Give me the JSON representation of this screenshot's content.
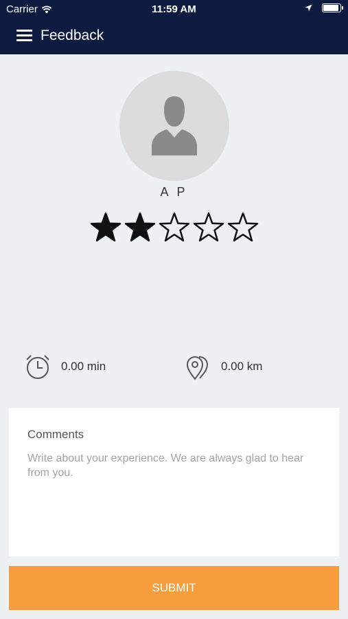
{
  "status_bar": {
    "carrier": "Carrier",
    "time": "11:59 AM",
    "battery_level": 0.95
  },
  "header": {
    "title": "Feedback",
    "menu_icon": "hamburger-icon"
  },
  "driver": {
    "name": "A P",
    "avatar_icon": "person-silhouette-icon"
  },
  "rating": {
    "value": 2,
    "max": 5
  },
  "metrics": {
    "time": {
      "icon": "alarm-clock-icon",
      "value": "0.00 min"
    },
    "distance": {
      "icon": "map-pin-icon",
      "value": "0.00 km"
    }
  },
  "comments": {
    "label": "Comments",
    "value": "",
    "placeholder": "Write about your experience. We are always glad to hear from you."
  },
  "submit": {
    "label": "SUBMIT"
  },
  "colors": {
    "header_bg": "#0c1b3f",
    "page_bg": "#edf1f4",
    "submit_bg": "#f79d3d",
    "star": "#111111"
  }
}
